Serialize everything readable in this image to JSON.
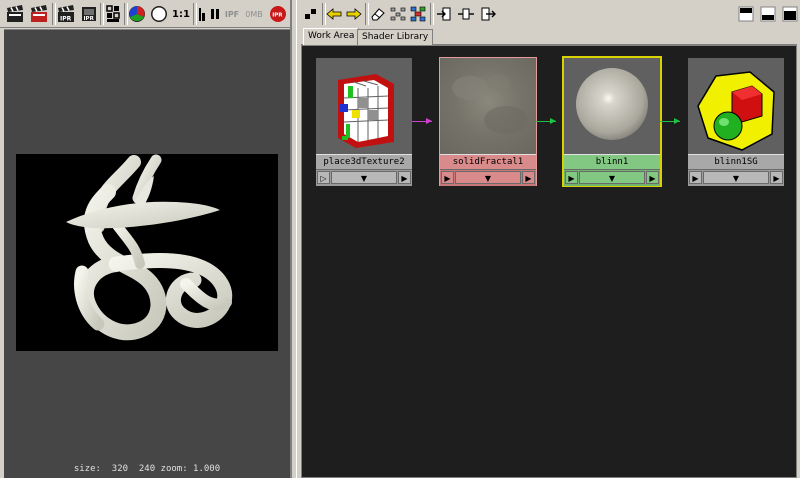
{
  "render_view": {
    "toolbar": {
      "ratio_label": "1:1",
      "ipr_label": "IPR",
      "ipr_file_label": "IPF",
      "memory_label": "0MB"
    },
    "status": {
      "text": "size:  320  240 zoom: 1.000"
    }
  },
  "hypershade": {
    "tabs": [
      {
        "label": "Work Area",
        "active": true
      },
      {
        "label": "Shader Library",
        "active": false
      }
    ],
    "nodes": [
      {
        "name": "place3dTexture2",
        "label_bg": "#a8a8a8",
        "highlight": "none"
      },
      {
        "name": "solidFractal1",
        "label_bg": "#d98a8a",
        "highlight": "#e39a9a"
      },
      {
        "name": "blinn1",
        "label_bg": "#82c882",
        "highlight": "#d7d200"
      },
      {
        "name": "blinn1SG",
        "label_bg": "#a8a8a8",
        "highlight": "none"
      }
    ],
    "port_glyphs": {
      "input_arrow": "▷",
      "input_filled": "▶",
      "menu_arrow": "▼",
      "output_arrow": "▶"
    }
  },
  "colors": {
    "background_gray": "#d4d0c8",
    "render_bg": "#464646",
    "work_area_bg": "#1e1e1e",
    "connection_magenta": "#d040d0",
    "connection_green": "#20c040"
  }
}
